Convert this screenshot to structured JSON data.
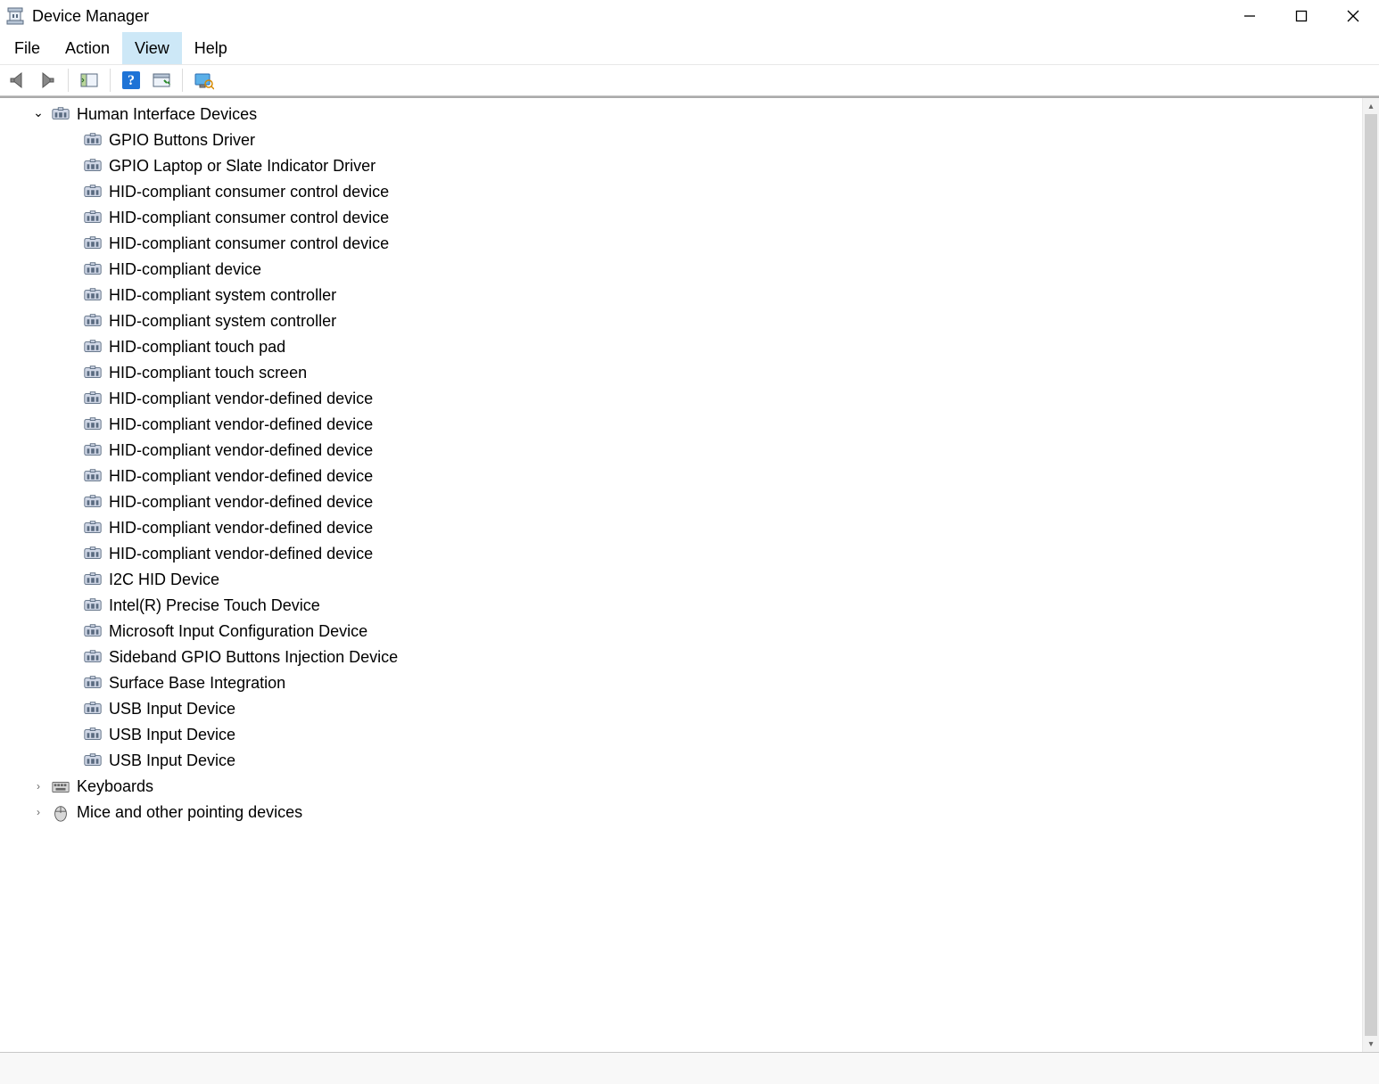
{
  "window": {
    "title": "Device Manager"
  },
  "menubar": {
    "items": [
      {
        "label": "File",
        "highlight": false
      },
      {
        "label": "Action",
        "highlight": false
      },
      {
        "label": "View",
        "highlight": true
      },
      {
        "label": "Help",
        "highlight": false
      }
    ]
  },
  "toolbar": {
    "buttons": [
      {
        "name": "nav-back-icon"
      },
      {
        "name": "nav-forward-icon"
      },
      {
        "name": "separator"
      },
      {
        "name": "show-hide-console-icon"
      },
      {
        "name": "separator"
      },
      {
        "name": "help-icon"
      },
      {
        "name": "properties-icon"
      },
      {
        "name": "separator"
      },
      {
        "name": "scan-hardware-icon"
      }
    ]
  },
  "tree": {
    "categories": [
      {
        "label": "Human Interface Devices",
        "expanded": true,
        "icon": "hid-category-icon",
        "devices": [
          "GPIO Buttons Driver",
          "GPIO Laptop or Slate Indicator Driver",
          "HID-compliant consumer control device",
          "HID-compliant consumer control device",
          "HID-compliant consumer control device",
          "HID-compliant device",
          "HID-compliant system controller",
          "HID-compliant system controller",
          "HID-compliant touch pad",
          "HID-compliant touch screen",
          "HID-compliant vendor-defined device",
          "HID-compliant vendor-defined device",
          "HID-compliant vendor-defined device",
          "HID-compliant vendor-defined device",
          "HID-compliant vendor-defined device",
          "HID-compliant vendor-defined device",
          "HID-compliant vendor-defined device",
          "I2C HID Device",
          "Intel(R) Precise Touch Device",
          "Microsoft Input Configuration Device",
          "Sideband GPIO Buttons Injection Device",
          "Surface Base Integration",
          "USB Input Device",
          "USB Input Device",
          "USB Input Device"
        ]
      },
      {
        "label": "Keyboards",
        "expanded": false,
        "icon": "keyboard-category-icon",
        "devices": []
      },
      {
        "label": "Mice and other pointing devices",
        "expanded": false,
        "icon": "mouse-category-icon",
        "devices": []
      }
    ]
  }
}
